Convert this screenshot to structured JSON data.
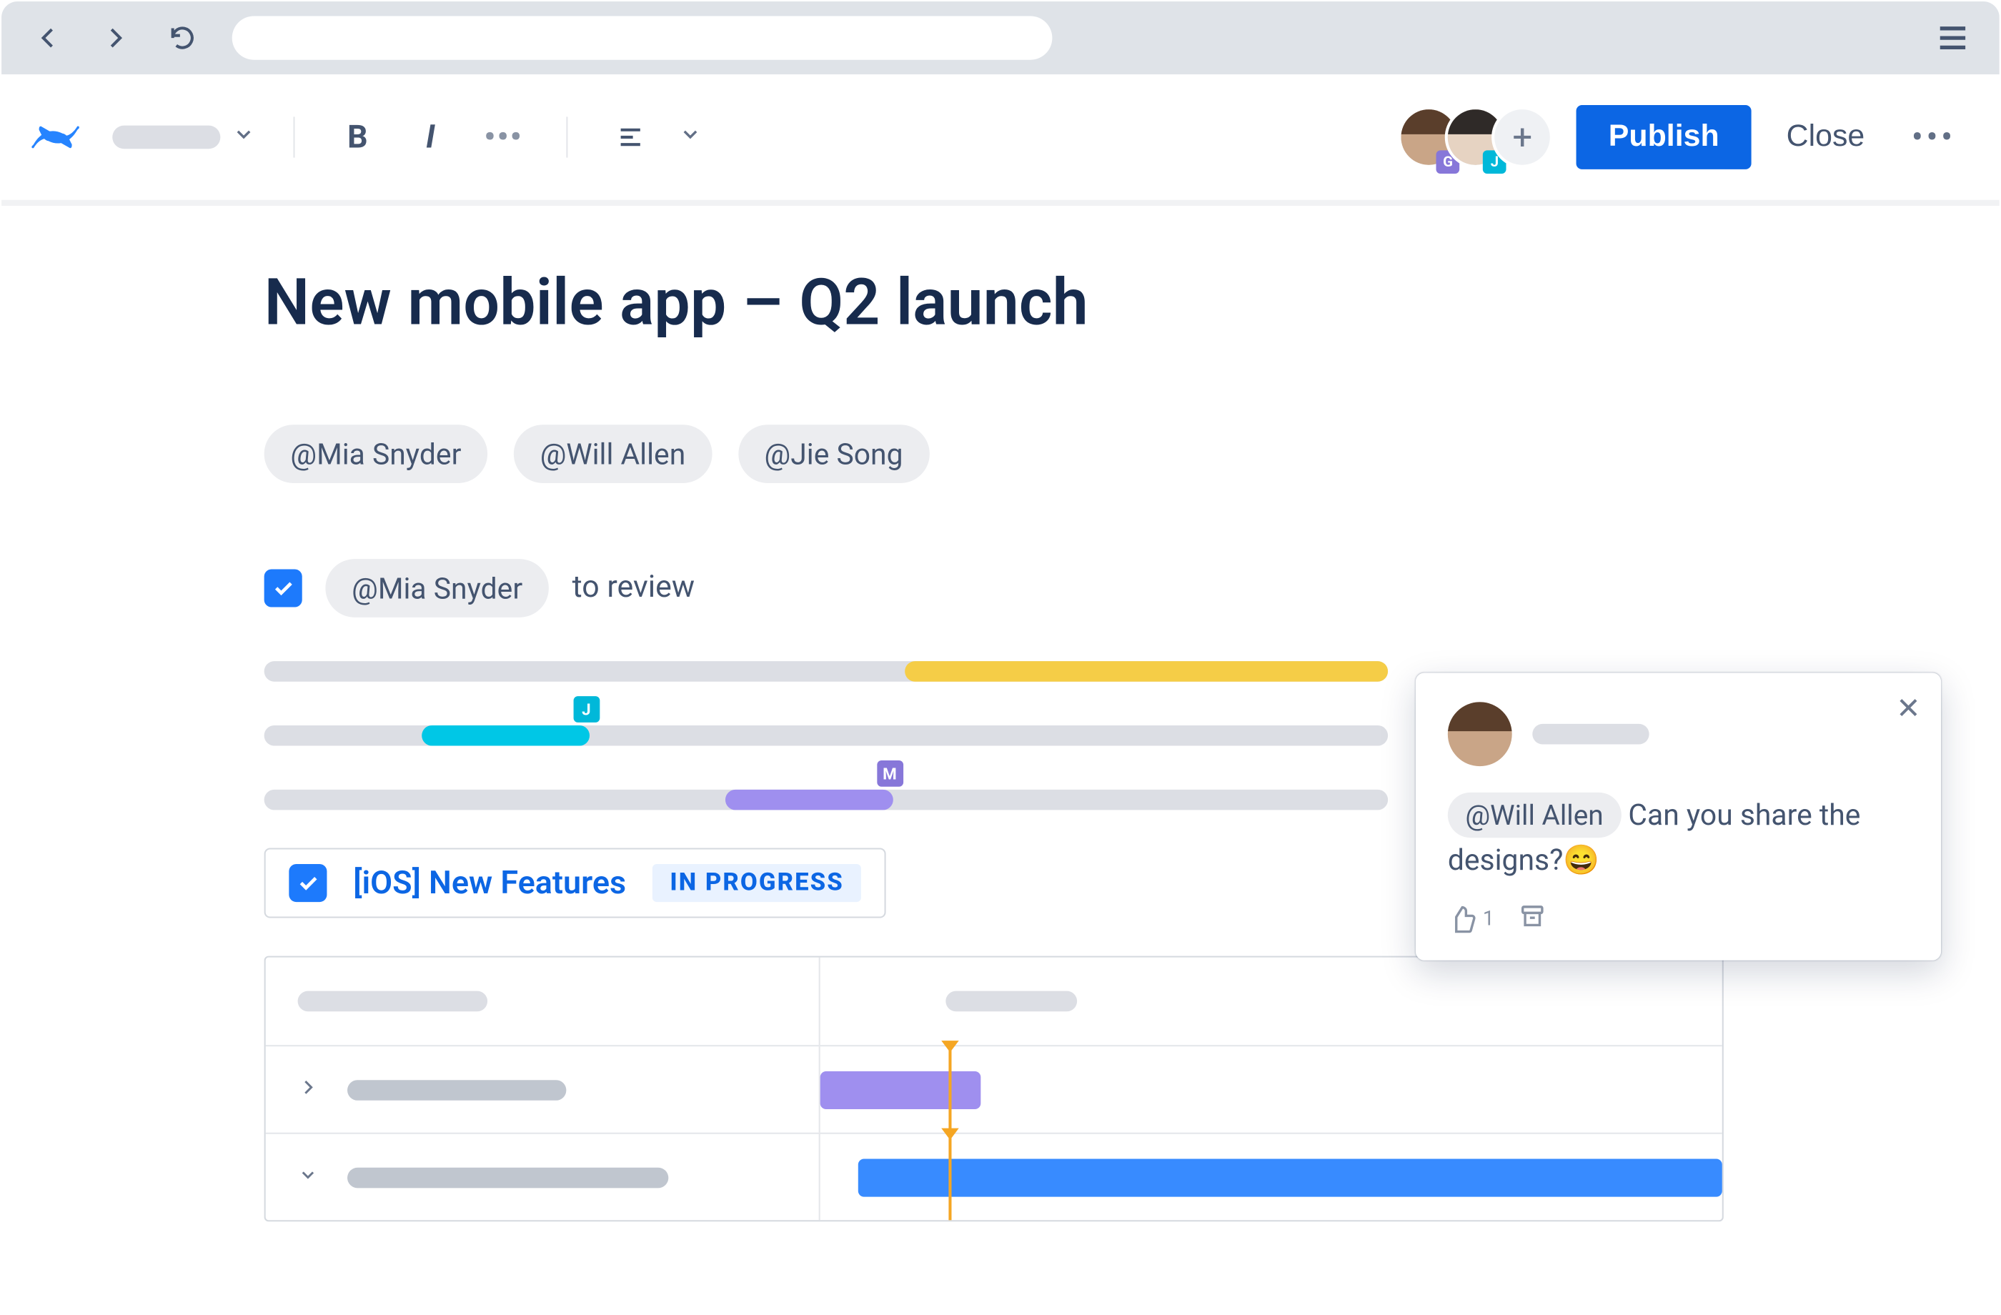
{
  "header": {
    "publish_label": "Publish",
    "close_label": "Close",
    "presence": [
      {
        "badge": "G",
        "badge_color": "purple"
      },
      {
        "badge": "J",
        "badge_color": "teal"
      }
    ]
  },
  "document": {
    "title": "New mobile app – Q2 launch",
    "mentions": [
      "@Mia Snyder",
      "@Will Allen",
      "@Jie Song"
    ],
    "task": {
      "checked": true,
      "assignee_mention": "@Mia Snyder",
      "text": "to review"
    },
    "timeline_bars": [
      {
        "fill_color": "yellow",
        "fill_start_pct": 57,
        "fill_end_pct": 100,
        "tag": null
      },
      {
        "fill_color": "teal",
        "fill_start_pct": 14,
        "fill_end_pct": 29,
        "tag": "J",
        "tag_color": "teal"
      },
      {
        "fill_color": "purple",
        "fill_start_pct": 41,
        "fill_end_pct": 56,
        "tag": "M",
        "tag_color": "purple"
      }
    ],
    "status_card": {
      "checked": true,
      "title": "[iOS] New Features",
      "status": "IN PROGRESS"
    }
  },
  "comment": {
    "mention": "@Will Allen",
    "text_after": "Can you share the designs?",
    "emoji": "😄",
    "likes": "1"
  }
}
